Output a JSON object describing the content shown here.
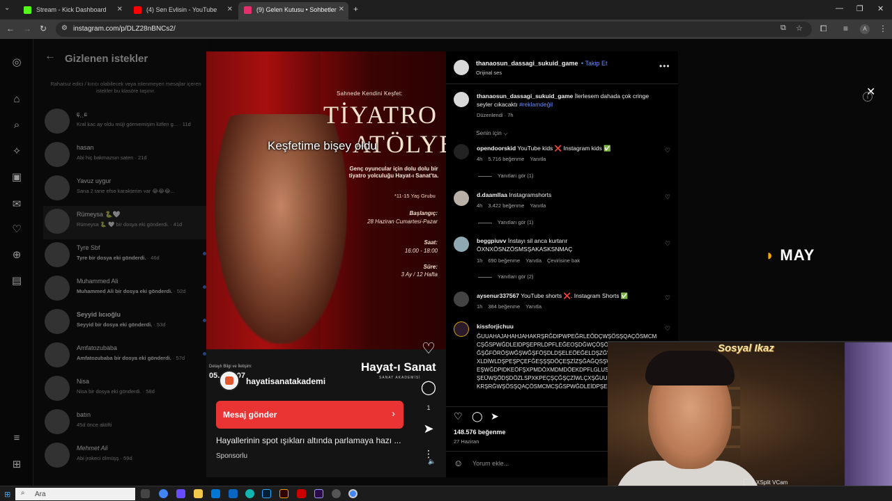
{
  "browser": {
    "tabs": [
      {
        "label": "Stream - Kick Dashboard",
        "active": false,
        "color": "#53fc18"
      },
      {
        "label": "(4) Sen Evlisin - YouTube",
        "active": false,
        "color": "#ff0000"
      },
      {
        "label": "(9) Gelen Kutusu • Sohbetler",
        "active": true,
        "color": "#e1306c"
      }
    ],
    "url": "instagram.com/p/DLZ28nBNCs2/"
  },
  "inbox": {
    "title": "Gizlenen istekler",
    "description": "Rahatsız edici / kırıcı olabilecek veya istenmeyen mesajlar içeren istekler bu klasöre taşınır.",
    "items": [
      {
        "name": "ɕ̦ˎˎɕ",
        "preview": "Kral kac ay oldu müji görmemişim lütfen g...",
        "time": "· 11d",
        "bold": false
      },
      {
        "name": "hasan",
        "preview": "Abi hiç bakmazsın saten",
        "time": "· 21d",
        "bold": false
      },
      {
        "name": "Yavuz uygur",
        "preview": "Sana 2 tane efso karakterim var 😂😂😂...",
        "time": "",
        "bold": false
      },
      {
        "name": "Rümeysa 🐍🤍",
        "preview": "Rümeysa 🐍 🤍 bir dosya eki gönderdi.",
        "time": "· 41d",
        "bold": false
      },
      {
        "name": "Tyre Sbf",
        "preview": "Tyre bir dosya eki gönderdi.",
        "time": "· 46d",
        "bold": true
      },
      {
        "name": "Muhammed Ali",
        "preview": "Muhammed Ali bir dosya eki gönderdi.",
        "time": "· 52d",
        "bold": true
      },
      {
        "name": "Seyyid Iıcıoğlu",
        "preview": "Seyyid bir dosya eki gönderdi.",
        "time": "· 53d",
        "bold": true
      },
      {
        "name": "Amfatozubaba",
        "preview": "Amfatozubaba bir dosya eki gönderdi.",
        "time": "· 57d",
        "bold": true
      },
      {
        "name": "Nisa",
        "preview": "Nisa bir dosya eki gönderdi.",
        "time": "· 58d",
        "bold": false
      },
      {
        "name": "batın",
        "preview": "45d önce aktifti",
        "time": "",
        "bold": false
      },
      {
        "name": "Mehmet Ali",
        "preview": "Abi jrokeci ölmüşş",
        "time": "· 59d",
        "bold": false
      }
    ]
  },
  "video": {
    "top_small": "Sahnede Kendini Keşfet:",
    "title_line1": "TİYATRO",
    "title_line2": "ATÖLYESİ",
    "overlay_caption": "Keşfetime bişey oldu",
    "desc": "Genç oyuncular için dolu dolu bir tiyatro yolculuğu Hayat-ı Sanat'ta.",
    "age": "*11-15 Yaş Grubu",
    "start_label": "Başlangıç:",
    "start_val": "28 Haziran Cumartesi-Pazar",
    "time_label": "Saat:",
    "time_val": "16:00 - 18:00",
    "dur_label": "Süre:",
    "dur_val": "3 Ay / 12 Hafta",
    "footer_small": "Detaylı Bilgi ve İletişim:",
    "footer_date": "05... 10 07",
    "logo": "Hayat-ı Sanat",
    "logo_sub": "SANAT AKADEMİSİ",
    "account": "hayatisanatakademi",
    "message_button": "Mesaj gönder",
    "caption": "Hayallerinin spot ışıkları altında parlamaya hazı ...",
    "sponsored": "Sponsorlu",
    "comment_count": "1"
  },
  "post": {
    "author": "thanaosun_dassagi_sukuid_game",
    "follow": "Takip Et",
    "audio": "Orijinal ses",
    "caption_author": "thanaosun_dassagi_sukuid_game",
    "caption_text": "İlerlesem dahada çok cringe seyler cıkacaktı",
    "caption_tag": "#reklamdeğil",
    "caption_meta": "Düzenlendi · 7h",
    "sort": "Senin için ⌵",
    "comments": [
      {
        "user": "opendoorskid",
        "text": "YouTube kids ❌ Instagram kids ✅",
        "time": "4h",
        "likes": "5.716 beğenme",
        "reply": "Yanıtla",
        "extra": "",
        "replies": "Yanıtları gör (1)"
      },
      {
        "user": "d.daamllaa",
        "text": "Instagramshorts",
        "time": "4h",
        "likes": "3.422 beğenme",
        "reply": "Yanıtla",
        "extra": "",
        "replies": "Yanıtları gör (1)"
      },
      {
        "user": "beggpiuvv",
        "text": "İnstayı sil anca kurtarır ÖXNXÖSNZÖSMSŞAKASKSNMAÇ",
        "time": "1h",
        "likes": "690 beğenme",
        "reply": "Yanıtla",
        "extra": "Çevirisine bak",
        "replies": "Yanıtları gör (2)"
      },
      {
        "user": "aysenur337567",
        "text": "YouTube shorts ❌. Instagram Shorts ✅",
        "time": "1h",
        "likes": "384 beğenme",
        "reply": "Yanıtla",
        "extra": "",
        "replies": ""
      }
    ],
    "spam_user": "kissforjichuu",
    "spam_text": "ĞUUAHAJAHAHJAHAKRŞRĞDIPWPEĞRLEÖDÇWŞÖSŞQAÇÖSMCMCŞĞSPWĞDLEIDPŞEPRLDPFLEĞEOŞDĞWÇÖŞÖŞÇÖŞÖŞWPSĞWĞŞĞFÖRÖŞWĞŞWĞŞFÖŞDLDŞELEÖEĞELDŞZĞWĞÖXŞQŞAĞŞSÖXLDİWLDŞPEŞPÇEFĞEŞŞŞDÖÇEŞZİZŞĞAĞQSŞWĞXŞİSĞWÖDİDÇEŞWĞDPIDKEÖFŞXPMDÖXMDMDÖEKDPFLGLUSUSHJSJSLDÜEĞDŞEÜWŞÖDŞDÖZLSPXKPEÇŞÇĞŞÇZİWLÇXŞĞUUAHJAJAHAHJAHAKRŞRĞWŞÖSŞQAÇÖSMCMCŞĞSPWĞDLEİDPŞEPRLD",
    "likes": "148.576 beğenme",
    "date": "27 Haziran",
    "add_comment_placeholder": "Yorum ekle..."
  },
  "overlay": {
    "brand": "MAY",
    "cam_title": "Sosyal Ikaz",
    "cam_brand": "XSplit VCam"
  },
  "taskbar": {
    "search_placeholder": "Ara"
  },
  "colors": {
    "accent_blue": "#6b8df5",
    "message_button": "#ea3333",
    "brand_orange": "#f5a800"
  }
}
